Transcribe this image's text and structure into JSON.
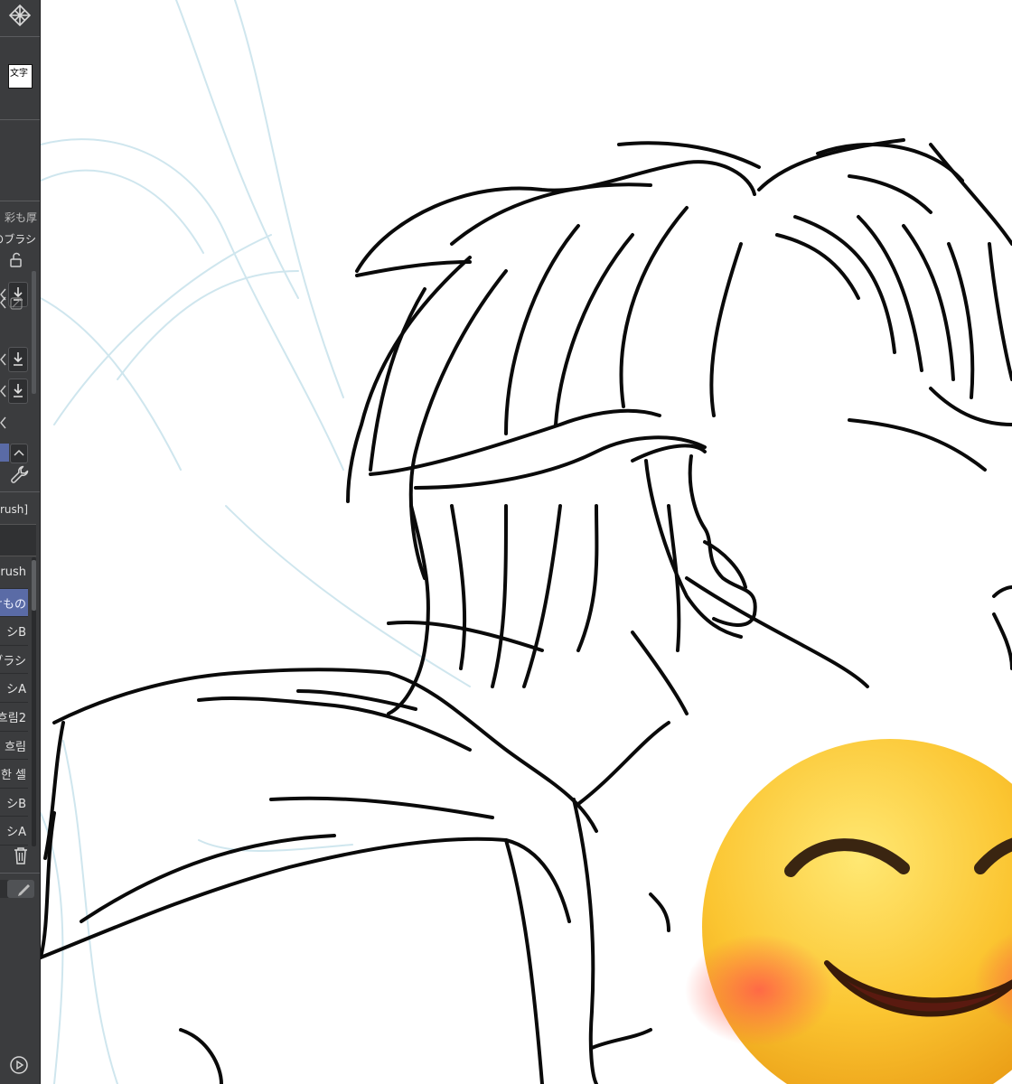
{
  "sidebar": {
    "tab_labels": [
      "彩も厚",
      "のブラシ"
    ],
    "brush_header": "rush]",
    "brushes": [
      {
        "label": "rush",
        "selected": false
      },
      {
        "label": "けもの",
        "selected": true
      },
      {
        "label": "シB",
        "selected": false
      },
      {
        "label": "ブラシ",
        "selected": false
      },
      {
        "label": "シA",
        "selected": false
      },
      {
        "label": "흐림2",
        "selected": false
      },
      {
        "label": "흐림",
        "selected": false
      },
      {
        "label": "한 셀",
        "selected": false
      },
      {
        "label": "シB",
        "selected": false
      },
      {
        "label": "シA",
        "selected": false
      }
    ],
    "text_tool_glyph": "文字"
  },
  "canvas": {
    "emoji": "smiling-face-with-smiling-eyes",
    "emoji_glyph": "😊"
  },
  "colors": {
    "panel_bg": "#3b3c3e",
    "selected_row": "#5a6ba6",
    "sketch_blue": "#cfe6ee",
    "ink": "#0a0a0a"
  }
}
